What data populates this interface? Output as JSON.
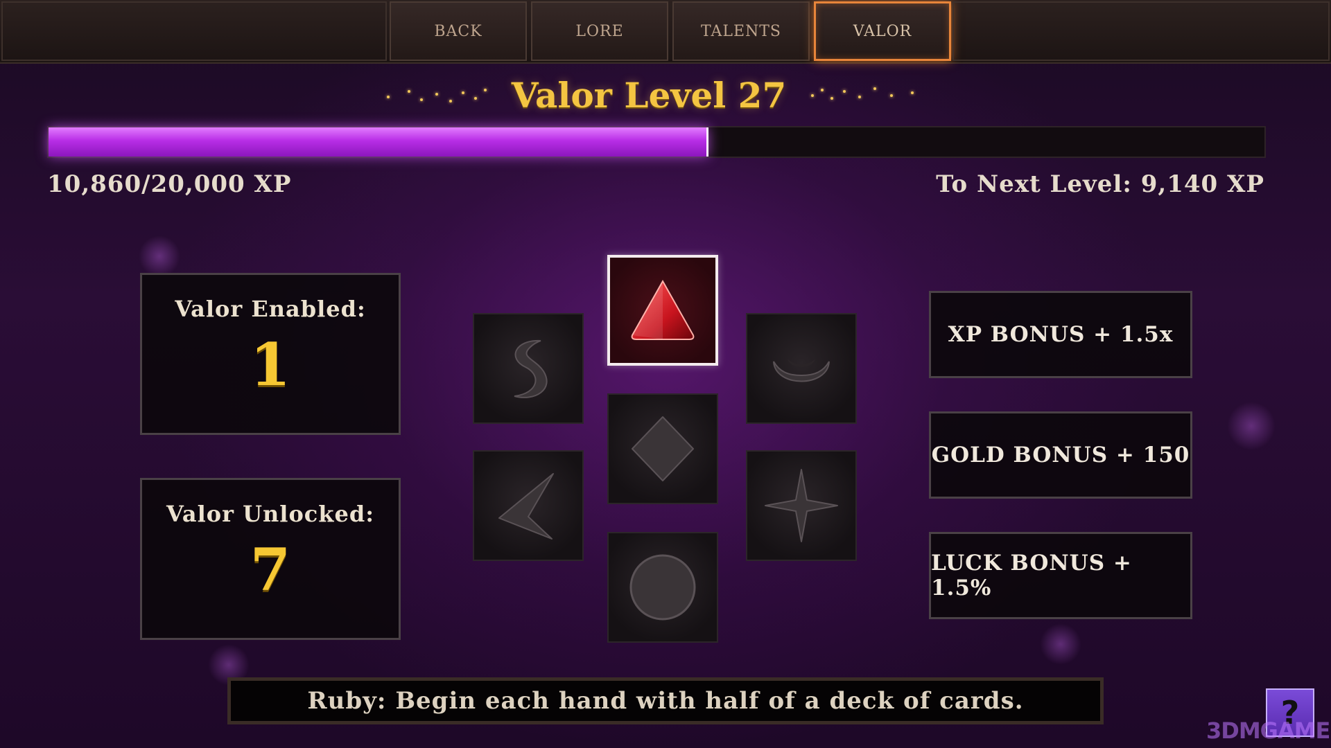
{
  "nav": {
    "tabs": [
      {
        "label": "BACK"
      },
      {
        "label": "LORE"
      },
      {
        "label": "TALENTS"
      },
      {
        "label": "VALOR",
        "active": true
      }
    ]
  },
  "header": {
    "title": "Valor Level 27"
  },
  "xp": {
    "current_text": "10,860/20,000 XP",
    "next_text": "To Next Level: 9,140 XP",
    "current": 10860,
    "max": 20000
  },
  "stats": {
    "enabled_label": "Valor Enabled:",
    "enabled_value": "1",
    "unlocked_label": "Valor Unlocked:",
    "unlocked_value": "7"
  },
  "gems": [
    {
      "icon": "triangle-gem-icon",
      "selected": true
    },
    {
      "icon": "s-shape-gem-icon"
    },
    {
      "icon": "crescent-gem-icon"
    },
    {
      "icon": "diamond-gem-icon"
    },
    {
      "icon": "chevron-gem-icon"
    },
    {
      "icon": "four-point-star-gem-icon"
    },
    {
      "icon": "circle-gem-icon"
    }
  ],
  "bonuses": {
    "xp": "XP BONUS + 1.5x",
    "gold": "GOLD BONUS + 150",
    "luck": "LUCK BONUS + 1.5%"
  },
  "description": "Ruby: Begin each hand with half of a deck of cards.",
  "help": {
    "label": "?"
  },
  "watermark": "3DMGAME",
  "colors": {
    "accent_gold": "#f4c542",
    "xp_purple": "#b82ee6",
    "tab_active_border": "#e8853a",
    "ruby_red": "#c8141e"
  }
}
